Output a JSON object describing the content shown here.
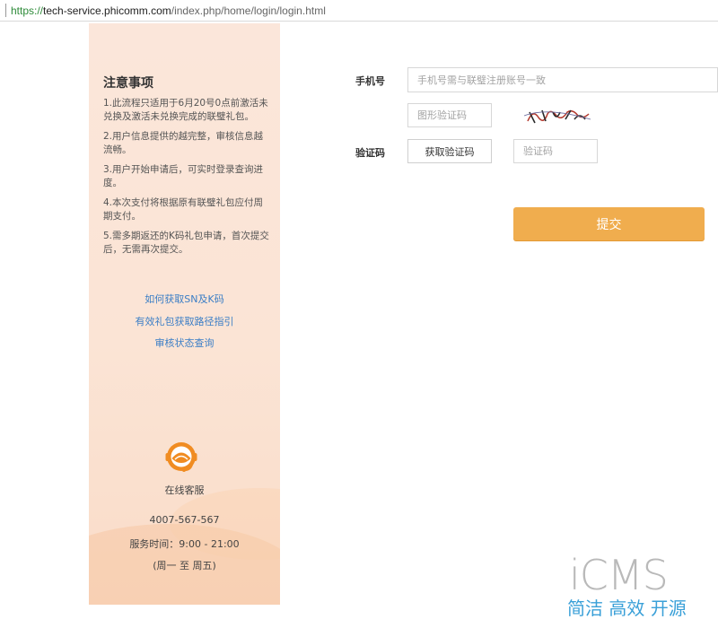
{
  "browser": {
    "url_scheme": "https://",
    "url_host": "tech-service.phicomm.com",
    "url_path": "/index.php/home/login/login.html"
  },
  "sidebar": {
    "notice_title": "注意事项",
    "notices": [
      "1.此流程只适用于6月20号0点前激活未兑换及激活未兑换完成的联璧礼包。",
      "2.用户信息提供的越完整，审核信息越流畅。",
      "3.用户开始申请后，可实时登录查询进度。",
      "4.本次支付将根据原有联璧礼包应付周期支付。",
      "5.需多期返还的K码礼包申请，首次提交后，无需再次提交。"
    ],
    "links": [
      "如何获取SN及K码",
      "有效礼包获取路径指引",
      "审核状态查询"
    ],
    "service": {
      "label": "在线客服",
      "phone": "4007-567-567",
      "hours": "服务时间：9:00 - 21:00",
      "days": "(周一 至 周五)"
    }
  },
  "form": {
    "phone_label": "手机号",
    "phone_placeholder": "手机号需与联璧注册账号一致",
    "phone_value": "",
    "captcha_placeholder": "图形验证码",
    "captcha_value": "",
    "sms_label": "验证码",
    "sms_button": "获取验证码",
    "sms_placeholder": "验证码",
    "sms_value": "",
    "submit_label": "提交"
  },
  "watermark": {
    "logo": "iCMS",
    "slogan": "简洁 高效 开源"
  },
  "colors": {
    "accent": "#f0ad4e",
    "link": "#3b7ec6",
    "sidebar_bg": "#fbe6da",
    "service_icon": "#f08c22"
  },
  "icons": {
    "service": "customer-service-headset-icon",
    "captcha": "captcha-image"
  }
}
